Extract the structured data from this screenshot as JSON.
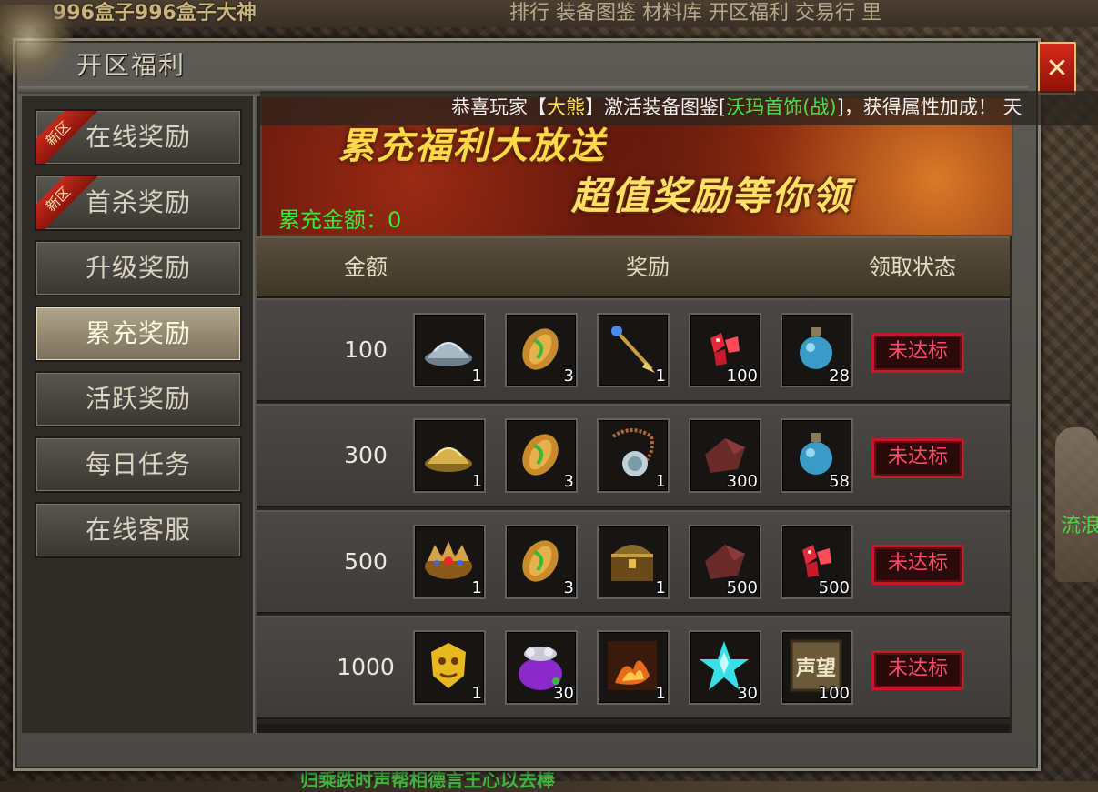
{
  "background": {
    "player_name": "996盒子996盒子大神",
    "top_tabs": "排行   装备图鉴   材料库   开区福利   交易行   里",
    "bottom_text": "归乘跌时声帮相德言王心以去棒",
    "right_npc_name": "流浪"
  },
  "window": {
    "title": "开区福利",
    "close_glyph": "✕"
  },
  "announcement": {
    "prefix": "恭喜玩家【",
    "player": "大熊",
    "middle": "】激活装备图鉴[",
    "item": "沃玛首饰(战)",
    "suffix": "]，获得属性加成！",
    "tail": "天"
  },
  "sidebar": {
    "items": [
      {
        "label": "在线奖励",
        "badge": "新区"
      },
      {
        "label": "首杀奖励",
        "badge": "新区"
      },
      {
        "label": "升级奖励",
        "badge": ""
      },
      {
        "label": "累充奖励",
        "badge": ""
      },
      {
        "label": "活跃奖励",
        "badge": ""
      },
      {
        "label": "每日任务",
        "badge": ""
      },
      {
        "label": "在线客服",
        "badge": ""
      }
    ],
    "active_index": 3
  },
  "banner": {
    "line1": "累充福利大放送",
    "line2": "超值奖励等你领",
    "amount_label": "累充金额：",
    "amount_value": "0"
  },
  "table": {
    "headers": {
      "amount": "金额",
      "reward": "奖励",
      "status": "领取状态"
    },
    "rows": [
      {
        "amount": "100",
        "status": "未达标",
        "items": [
          {
            "icon": "hat-icon",
            "count": "1"
          },
          {
            "icon": "seed-icon",
            "count": "3"
          },
          {
            "icon": "staff-icon",
            "count": "1"
          },
          {
            "icon": "ruby-icon",
            "count": "100"
          },
          {
            "icon": "potion-icon",
            "count": "28"
          }
        ]
      },
      {
        "amount": "300",
        "status": "未达标",
        "items": [
          {
            "icon": "gold-hat-icon",
            "count": "1"
          },
          {
            "icon": "seed-icon",
            "count": "3"
          },
          {
            "icon": "necklace-icon",
            "count": "1"
          },
          {
            "icon": "cloth-icon",
            "count": "300"
          },
          {
            "icon": "potion-icon",
            "count": "58"
          }
        ]
      },
      {
        "amount": "500",
        "status": "未达标",
        "items": [
          {
            "icon": "crown-icon",
            "count": "1"
          },
          {
            "icon": "seed-icon",
            "count": "3"
          },
          {
            "icon": "chest-icon",
            "count": "1"
          },
          {
            "icon": "cloth-icon",
            "count": "500"
          },
          {
            "icon": "ruby-icon",
            "count": "500"
          }
        ]
      },
      {
        "amount": "1000",
        "status": "未达标",
        "items": [
          {
            "icon": "gold-mask-icon",
            "count": "1"
          },
          {
            "icon": "treasure-bag-icon",
            "count": "30"
          },
          {
            "icon": "fire-scroll-icon",
            "count": "1"
          },
          {
            "icon": "crystal-icon",
            "count": "30"
          },
          {
            "icon": "reputation-icon",
            "count": "100",
            "label": "声望"
          }
        ]
      }
    ]
  }
}
